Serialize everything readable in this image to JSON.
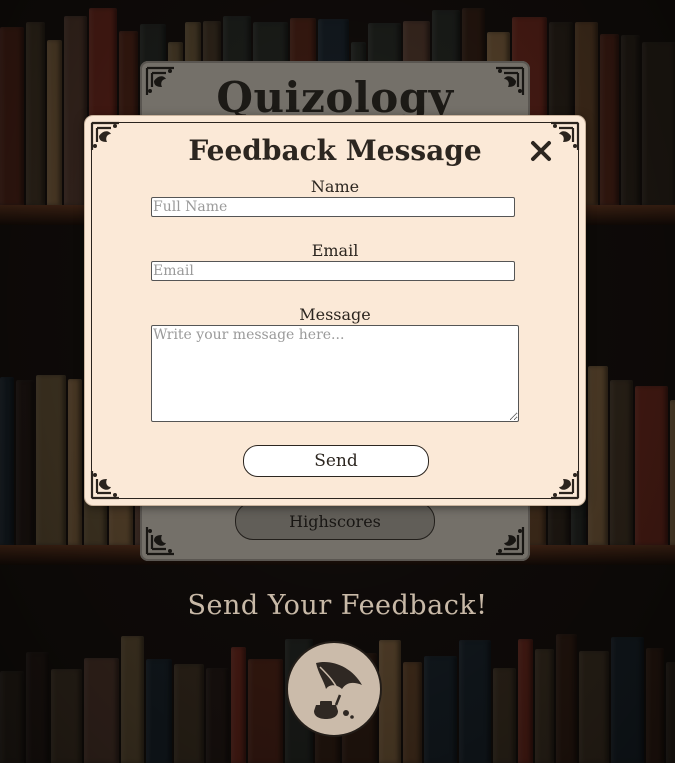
{
  "app": {
    "title": "Quizology",
    "highscores_label": "Highscores"
  },
  "modal": {
    "title": "Feedback Message",
    "name_label": "Name",
    "name_placeholder": "Full Name",
    "name_value": "",
    "email_label": "Email",
    "email_placeholder": "Email",
    "email_value": "",
    "message_label": "Message",
    "message_placeholder": "Write your message here...",
    "message_value": "",
    "send_label": "Send",
    "close_icon": "close-icon"
  },
  "footer": {
    "heading": "Send Your Feedback!",
    "feedback_icon": "quill-inkpot-icon"
  },
  "colors": {
    "modal_background": "#fbe9d7",
    "text_dark": "#2c2620",
    "heading_light": "#f4e2cc"
  }
}
